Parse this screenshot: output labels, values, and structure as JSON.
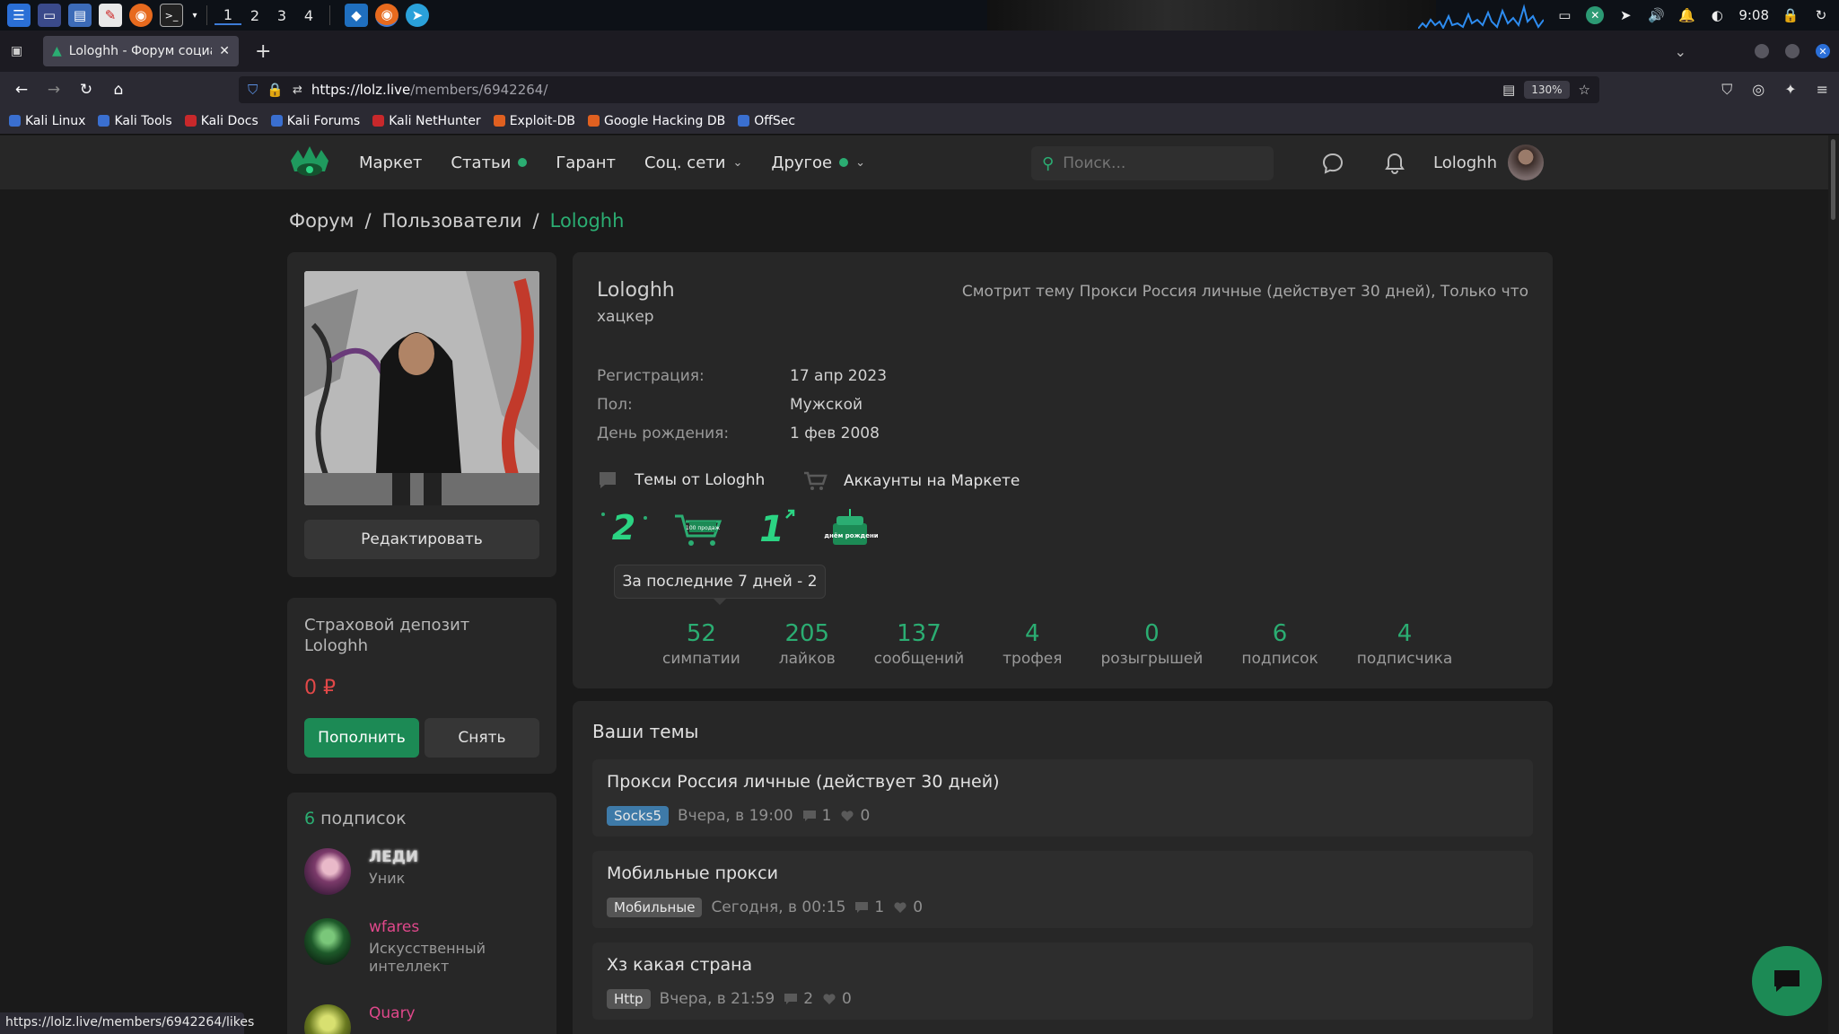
{
  "system_panel": {
    "workspaces": [
      "1",
      "2",
      "3",
      "4"
    ],
    "active_workspace": "1",
    "clock": "9:08",
    "icons": [
      "kali-menu-icon",
      "desktop-icon",
      "files-icon",
      "text-editor-icon",
      "firefox-icon",
      "terminal-icon",
      "vscode-icon",
      "firefox-icon",
      "telegram-icon"
    ]
  },
  "browser": {
    "tab_title": "Lologhh - Форум социал",
    "url_host": "https://lolz.live",
    "url_path": "/members/6942264/",
    "zoom": "130%",
    "bookmarks": [
      {
        "label": "Kali Linux",
        "color": "#3a6fd0"
      },
      {
        "label": "Kali Tools",
        "color": "#3a6fd0"
      },
      {
        "label": "Kali Docs",
        "color": "#c8282b"
      },
      {
        "label": "Kali Forums",
        "color": "#3a6fd0"
      },
      {
        "label": "Kali NetHunter",
        "color": "#c8282b"
      },
      {
        "label": "Exploit-DB",
        "color": "#e06020"
      },
      {
        "label": "Google Hacking DB",
        "color": "#e06020"
      },
      {
        "label": "OffSec",
        "color": "#3a6fd0"
      }
    ],
    "status_url": "https://lolz.live/members/6942264/likes"
  },
  "site": {
    "accent": "#2bad72",
    "menu": [
      {
        "label": "Маркет",
        "dot": false,
        "chevron": false
      },
      {
        "label": "Статьи",
        "dot": true,
        "chevron": false
      },
      {
        "label": "Гарант",
        "dot": false,
        "chevron": false
      },
      {
        "label": "Соц. сети",
        "dot": false,
        "chevron": true
      },
      {
        "label": "Другое",
        "dot": true,
        "chevron": true
      }
    ],
    "search_placeholder": "Поиск...",
    "username": "Lologhh"
  },
  "breadcrumb": [
    "Форум",
    "Пользователи",
    "Lologhh"
  ],
  "left": {
    "edit_button": "Редактировать",
    "deposit_title": "Страховой депозит Lologhh",
    "deposit_amount": "0 ₽",
    "topup_button": "Пополнить",
    "withdraw_button": "Снять",
    "subs_count": "6",
    "subs_label": " подписок",
    "subscriptions": [
      {
        "name": "ЛЕДИ",
        "role": "Уник",
        "name_color": "#ffffff"
      },
      {
        "name": "wfares",
        "role": "Искусственный интеллект",
        "name_color": "#e0488b"
      },
      {
        "name": "Quary",
        "role": "",
        "name_color": "#e0488b"
      }
    ]
  },
  "profile": {
    "name": "Lologhh",
    "role": "хацкер",
    "activity": "Смотрит тему Прокси Россия личные (действует 30 дней), Только что",
    "info": [
      {
        "k": "Регистрация:",
        "v": "17 апр 2023"
      },
      {
        "k": "Пол:",
        "v": "Мужской"
      },
      {
        "k": "День рождения:",
        "v": "1 фев 2008"
      }
    ],
    "link_topics": "Темы от Lologhh",
    "link_market": "Аккаунты на Маркете",
    "trophy_texts": [
      "2",
      "100 продаж",
      "1",
      "С днём рождения"
    ],
    "tooltip": "За последние 7 дней - 2",
    "stats": [
      {
        "num": "52",
        "lbl": "симпатии"
      },
      {
        "num": "205",
        "lbl": "лайков"
      },
      {
        "num": "137",
        "lbl": "сообщений"
      },
      {
        "num": "4",
        "lbl": "трофея"
      },
      {
        "num": "0",
        "lbl": "розыгрышей"
      },
      {
        "num": "6",
        "lbl": "подписок"
      },
      {
        "num": "4",
        "lbl": "подписчика"
      }
    ]
  },
  "topics": {
    "title": "Ваши темы",
    "items": [
      {
        "title": "Прокси Россия личные (действует 30 дней)",
        "tag": "Socks5",
        "tag_color": "#3e7aa8",
        "time": "Вчера, в 19:00",
        "replies": "1",
        "likes": "0"
      },
      {
        "title": "Мобильные прокси",
        "tag": "Мобильные",
        "tag_color": "#555555",
        "time": "Сегодня, в 00:15",
        "replies": "1",
        "likes": "0"
      },
      {
        "title": "Хз какая страна",
        "tag": "Http",
        "tag_color": "#555555",
        "time": "Вчера, в 21:59",
        "replies": "2",
        "likes": "0"
      }
    ]
  }
}
